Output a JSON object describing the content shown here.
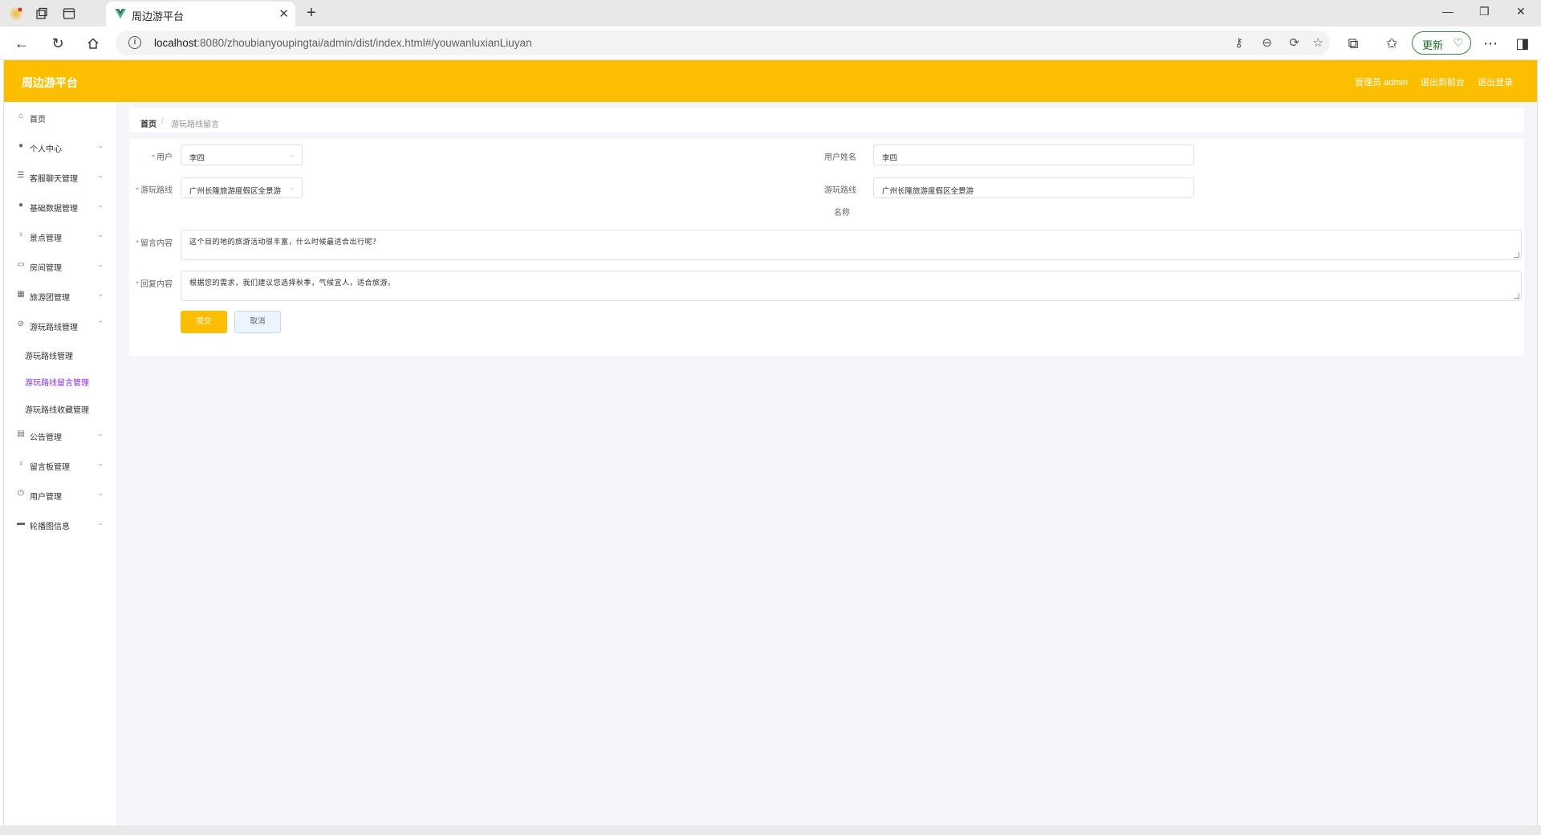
{
  "browser": {
    "tab_title": "周边游平台",
    "url_host": "localhost",
    "url_rest": ":8080/zhoubianyoupingtai/admin/dist/index.html#/youwanluxianLiuyan",
    "update_label": "更新"
  },
  "header": {
    "brand": "周边游平台",
    "admin_label": "管理员 admin",
    "to_frontend": "退出到前台",
    "logout": "退出登录"
  },
  "sidebar": {
    "items": [
      {
        "label": "首页",
        "icon": "home-icon"
      },
      {
        "label": "个人中心",
        "icon": "user-icon"
      },
      {
        "label": "客服聊天管理",
        "icon": "sliders-icon"
      },
      {
        "label": "基础数据管理",
        "icon": "location-icon"
      },
      {
        "label": "景点管理",
        "icon": "microphone-icon"
      },
      {
        "label": "房间管理",
        "icon": "chat-icon"
      },
      {
        "label": "旅游团管理",
        "icon": "grid-icon"
      },
      {
        "label": "游玩路线管理",
        "icon": "disabled-bell-icon"
      },
      {
        "label": "公告管理",
        "icon": "trash-icon"
      },
      {
        "label": "留言板管理",
        "icon": "microphone-icon"
      },
      {
        "label": "用户管理",
        "icon": "power-icon"
      },
      {
        "label": "轮播图信息",
        "icon": "chat-icon"
      }
    ],
    "sub_items": [
      {
        "label": "游玩路线管理"
      },
      {
        "label": "游玩路线留言管理"
      },
      {
        "label": "游玩路线收藏管理"
      }
    ]
  },
  "breadcrumb": {
    "home": "首页",
    "separator": "/",
    "current": "游玩路线留言"
  },
  "form": {
    "user_label": "用户",
    "user_value": "李四",
    "user_name_label": "用户姓名",
    "user_name_value": "李四",
    "route_label": "游玩路线",
    "route_value": "广州长隆旅游度假区全景游",
    "route_name_label_1": "游玩路线",
    "route_name_label_2": "名称",
    "route_name_value": "广州长隆旅游度假区全景游",
    "message_label": "留言内容",
    "message_value": "这个目的地的旅游活动很丰富，什么时候最适合出行呢？",
    "reply_label": "回复内容",
    "reply_value": "根据您的需求，我们建议您选择秋季，气候宜人，适合旅游。",
    "submit_label": "提交",
    "cancel_label": "取消"
  },
  "colors": {
    "brand": "#fbbe00",
    "active_sub": "#8a2be2",
    "required": "#f56c6c"
  }
}
